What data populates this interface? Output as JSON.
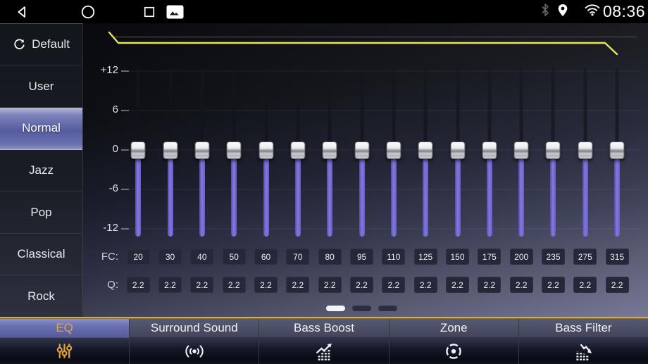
{
  "status_bar": {
    "time": "08:36",
    "nav": [
      {
        "name": "back"
      },
      {
        "name": "home"
      },
      {
        "name": "recents"
      },
      {
        "name": "screenshot"
      }
    ],
    "indicators": [
      {
        "name": "bluetooth"
      },
      {
        "name": "location"
      },
      {
        "name": "wifi"
      }
    ]
  },
  "sidebar": {
    "items": [
      {
        "label": "Default",
        "icon": "refresh-icon",
        "selected": false
      },
      {
        "label": "User",
        "selected": false
      },
      {
        "label": "Normal",
        "selected": true
      },
      {
        "label": "Jazz",
        "selected": false
      },
      {
        "label": "Pop",
        "selected": false
      },
      {
        "label": "Classical",
        "selected": false
      },
      {
        "label": "Rock",
        "selected": false
      }
    ]
  },
  "equalizer": {
    "scale_labels": [
      "+12",
      "6",
      "0",
      "-6",
      "-12"
    ],
    "fc_label": "FC:",
    "q_label": "Q:",
    "bands": [
      {
        "fc": "20",
        "q": "2.2",
        "gain_db": 0
      },
      {
        "fc": "30",
        "q": "2.2",
        "gain_db": 0
      },
      {
        "fc": "40",
        "q": "2.2",
        "gain_db": 0
      },
      {
        "fc": "50",
        "q": "2.2",
        "gain_db": 0
      },
      {
        "fc": "60",
        "q": "2.2",
        "gain_db": 0
      },
      {
        "fc": "70",
        "q": "2.2",
        "gain_db": 0
      },
      {
        "fc": "80",
        "q": "2.2",
        "gain_db": 0
      },
      {
        "fc": "95",
        "q": "2.2",
        "gain_db": 0
      },
      {
        "fc": "110",
        "q": "2.2",
        "gain_db": 0
      },
      {
        "fc": "125",
        "q": "2.2",
        "gain_db": 0
      },
      {
        "fc": "150",
        "q": "2.2",
        "gain_db": 0
      },
      {
        "fc": "175",
        "q": "2.2",
        "gain_db": 0
      },
      {
        "fc": "200",
        "q": "2.2",
        "gain_db": 0
      },
      {
        "fc": "235",
        "q": "2.2",
        "gain_db": 0
      },
      {
        "fc": "275",
        "q": "2.2",
        "gain_db": 0
      },
      {
        "fc": "315",
        "q": "2.2",
        "gain_db": 0
      }
    ]
  },
  "pager": {
    "total": 3,
    "active_index": 0
  },
  "tab_bar": {
    "tabs": [
      {
        "label": "EQ",
        "icon": "eq-sliders-icon",
        "selected": true
      },
      {
        "label": "Surround Sound",
        "icon": "surround-sound-icon",
        "selected": false
      },
      {
        "label": "Bass Boost",
        "icon": "bass-boost-icon",
        "selected": false
      },
      {
        "label": "Zone",
        "icon": "zone-target-icon",
        "selected": false
      },
      {
        "label": "Bass Filter",
        "icon": "bass-filter-icon",
        "selected": false
      }
    ]
  },
  "colors": {
    "accent_gold": "#e2a33c",
    "slider_purple": "#7265c8",
    "curve_yellow": "#e9e45e",
    "selected_preset_mid": "#555c9e",
    "tab_selected_mid": "#6a6fb0"
  }
}
